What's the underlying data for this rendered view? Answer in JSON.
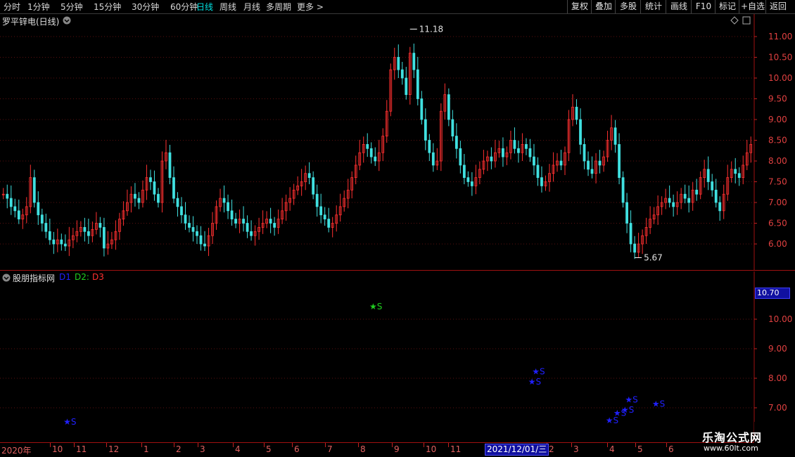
{
  "toolbar": {
    "periods": [
      "分时",
      "1分钟",
      "5分钟",
      "15分钟",
      "30分钟",
      "60分钟",
      "日线",
      "周线",
      "月线",
      "多周期",
      "更多 >"
    ],
    "active_period": "日线",
    "right_buttons": [
      "复权",
      "叠加",
      "多股",
      "统计",
      "画线",
      "F10",
      "标记",
      "+自选",
      "返回"
    ]
  },
  "main_chart": {
    "title": "罗平锌电(日线)",
    "y_ticks": [
      "11.00",
      "10.50",
      "10.00",
      "9.50",
      "9.00",
      "8.50",
      "8.00",
      "7.50",
      "7.00",
      "6.50",
      "6.00"
    ],
    "high_label": "11.18",
    "low_label": "5.67"
  },
  "indicator": {
    "title": "股朋指标网",
    "lines": [
      {
        "name": "D1",
        "color": "#2020ff"
      },
      {
        "name": "D2:",
        "color": "#20d020"
      },
      {
        "name": "D3",
        "color": "#ff3030"
      }
    ],
    "y_ticks": [
      "10.00",
      "9.00",
      "8.00",
      "7.00"
    ],
    "current_value": "10.70",
    "signals": [
      {
        "label": "★S",
        "price": 6.55,
        "color": "#2020ff",
        "index": 16
      },
      {
        "label": "★S",
        "price": 10.45,
        "color": "#20d020",
        "index": 95
      },
      {
        "label": "★S",
        "price": 8.25,
        "color": "#2020ff",
        "index": 137
      },
      {
        "label": "★S",
        "price": 7.9,
        "color": "#2020ff",
        "index": 136
      },
      {
        "label": "★S",
        "price": 6.6,
        "color": "#2020ff",
        "index": 156
      },
      {
        "label": "★S",
        "price": 6.85,
        "color": "#2020ff",
        "index": 158
      },
      {
        "label": "★S",
        "price": 6.95,
        "color": "#2020ff",
        "index": 160
      },
      {
        "label": "★S",
        "price": 7.3,
        "color": "#2020ff",
        "index": 161
      },
      {
        "label": "★S",
        "price": 7.15,
        "color": "#2020ff",
        "index": 168
      }
    ]
  },
  "time_axis": {
    "labels": [
      "2020年",
      "10",
      "11",
      "12",
      "1",
      "2",
      "3",
      "4",
      "5",
      "6",
      "7",
      "8",
      "9",
      "10",
      "11",
      "2",
      "3",
      "4",
      "5",
      "6"
    ],
    "cursor_date": "2021/12/01/三"
  },
  "watermark": {
    "brand": "乐淘公式网",
    "url": "www.60lt.com"
  },
  "chart_data": {
    "type": "candlestick",
    "title": "罗平锌电(日线)",
    "ylim": [
      5.5,
      11.4
    ],
    "up_color": "#ff3030",
    "down_color": "#40e0e0",
    "closes": [
      7.2,
      7.1,
      6.9,
      6.8,
      6.6,
      6.7,
      6.9,
      7.6,
      7.0,
      6.7,
      6.5,
      6.3,
      6.1,
      6.0,
      6.1,
      6.0,
      5.95,
      6.1,
      6.2,
      6.3,
      6.4,
      6.3,
      6.2,
      6.35,
      6.5,
      6.4,
      5.9,
      6.0,
      6.1,
      6.3,
      6.6,
      6.8,
      7.0,
      7.2,
      7.1,
      7.0,
      7.3,
      7.6,
      7.5,
      7.2,
      7.0,
      8.0,
      8.2,
      7.6,
      7.1,
      6.9,
      6.7,
      6.5,
      6.4,
      6.3,
      6.2,
      6.0,
      5.95,
      6.2,
      6.5,
      6.9,
      7.1,
      7.0,
      6.8,
      6.6,
      6.5,
      6.6,
      6.5,
      6.3,
      6.2,
      6.3,
      6.4,
      6.5,
      6.6,
      6.5,
      6.4,
      6.6,
      6.8,
      7.0,
      7.1,
      7.3,
      7.4,
      7.5,
      7.7,
      7.6,
      7.2,
      6.9,
      6.7,
      6.6,
      6.4,
      6.5,
      6.7,
      6.9,
      7.1,
      7.3,
      7.6,
      7.9,
      8.2,
      8.4,
      8.3,
      8.1,
      8.0,
      8.2,
      8.6,
      9.2,
      10.2,
      10.5,
      10.2,
      10.0,
      9.6,
      10.6,
      10.2,
      9.5,
      9.0,
      8.5,
      8.2,
      7.9,
      8.0,
      9.2,
      9.6,
      9.0,
      8.6,
      8.3,
      7.9,
      7.6,
      7.5,
      7.4,
      7.6,
      7.8,
      8.0,
      8.1,
      8.0,
      8.2,
      8.3,
      8.1,
      8.2,
      8.5,
      8.3,
      8.2,
      8.4,
      8.3,
      8.1,
      7.9,
      7.6,
      7.4,
      7.5,
      7.7,
      7.9,
      8.0,
      7.9,
      8.2,
      9.0,
      9.3,
      9.0,
      8.4,
      8.0,
      7.8,
      7.7,
      8.0,
      7.9,
      8.1,
      8.5,
      8.8,
      8.4,
      7.6,
      7.0,
      6.5,
      6.0,
      5.8,
      6.0,
      6.2,
      6.4,
      6.6,
      6.7,
      6.9,
      7.0,
      7.1,
      7.0,
      6.9,
      7.0,
      7.2,
      7.1,
      7.0,
      7.3,
      7.2,
      7.6,
      7.8,
      7.5,
      7.3,
      7.0,
      6.8,
      7.2,
      7.6,
      7.8,
      7.7,
      7.6,
      7.9,
      8.2,
      8.4
    ]
  }
}
